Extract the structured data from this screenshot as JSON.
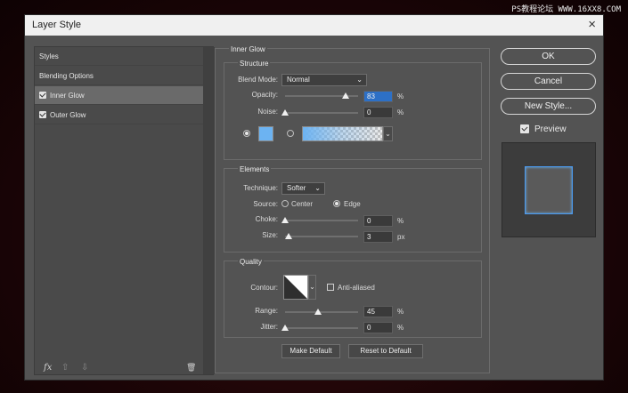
{
  "watermark": "PS教程论坛 WWW.16XX8.COM",
  "dialog": {
    "title": "Layer Style",
    "close_icon": "×"
  },
  "left_panel": {
    "items": [
      {
        "label": "Styles",
        "checked": false,
        "selected": false
      },
      {
        "label": "Blending Options",
        "checked": false,
        "selected": false
      },
      {
        "label": "Inner Glow",
        "checked": true,
        "selected": true
      },
      {
        "label": "Outer Glow",
        "checked": true,
        "selected": false
      }
    ],
    "footer": {
      "fx": "fx",
      "up": "⇧",
      "down": "⇩",
      "trash": "🗑"
    }
  },
  "inner_glow": {
    "title": "Inner Glow",
    "structure": {
      "title": "Structure",
      "blend_mode_label": "Blend Mode:",
      "blend_mode_value": "Normal",
      "opacity_label": "Opacity:",
      "opacity_value": "83",
      "opacity_unit": "%",
      "noise_label": "Noise:",
      "noise_value": "0",
      "noise_unit": "%",
      "color": "#6cb3f2"
    },
    "elements": {
      "title": "Elements",
      "technique_label": "Technique:",
      "technique_value": "Softer",
      "source_label": "Source:",
      "source_center": "Center",
      "source_edge": "Edge",
      "source_selected": "Edge",
      "choke_label": "Choke:",
      "choke_value": "0",
      "choke_unit": "%",
      "size_label": "Size:",
      "size_value": "3",
      "size_unit": "px"
    },
    "quality": {
      "title": "Quality",
      "contour_label": "Contour:",
      "anti_aliased_label": "Anti-aliased",
      "anti_aliased": false,
      "range_label": "Range:",
      "range_value": "45",
      "range_unit": "%",
      "jitter_label": "Jitter:",
      "jitter_value": "0",
      "jitter_unit": "%"
    },
    "make_default": "Make Default",
    "reset_default": "Reset to Default"
  },
  "right": {
    "ok": "OK",
    "cancel": "Cancel",
    "new_style": "New Style...",
    "preview_label": "Preview",
    "preview_checked": true
  }
}
